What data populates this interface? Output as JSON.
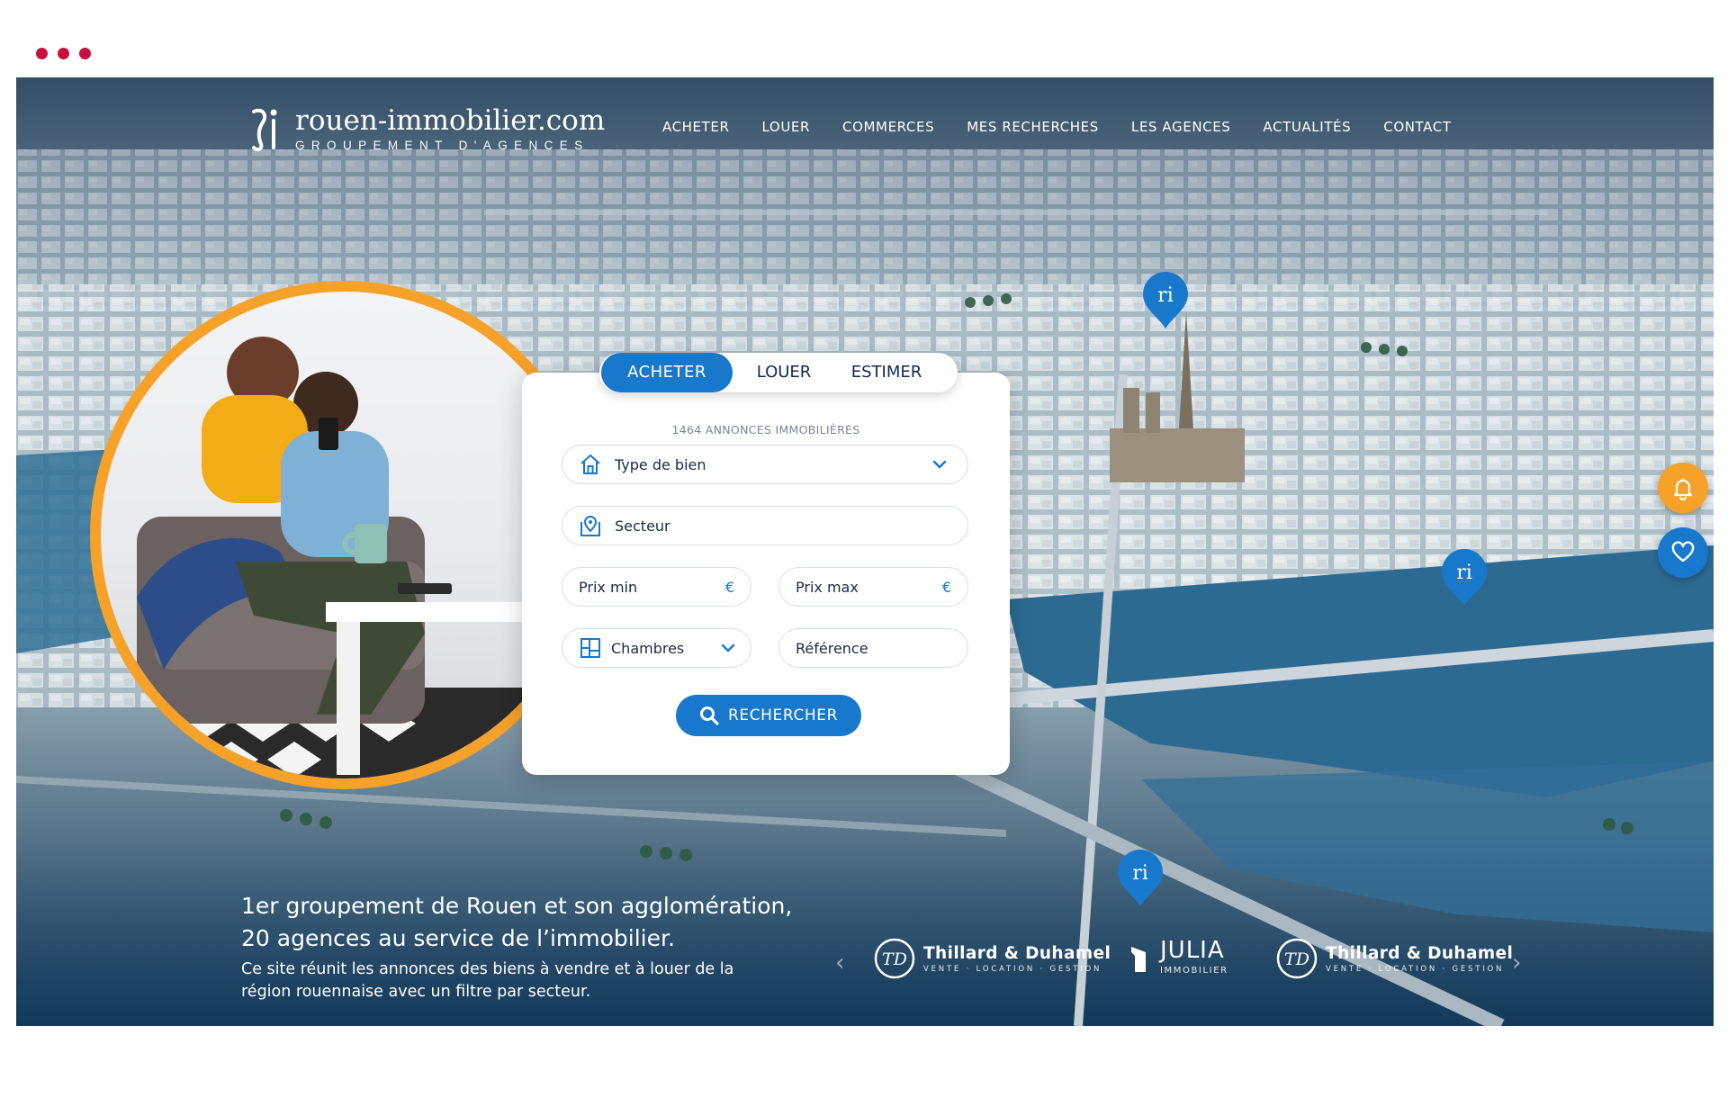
{
  "window": {
    "dot_colors": [
      "#c8103e",
      "#c8103e",
      "#c8103e"
    ]
  },
  "header": {
    "logo_title": "rouen-immobilier.com",
    "logo_subtitle": "GROUPEMENT D'AGENCES",
    "nav": [
      "ACHETER",
      "LOUER",
      "COMMERCES",
      "MES RECHERCHES",
      "LES AGENCES",
      "ACTUALITÉS",
      "CONTACT"
    ]
  },
  "search": {
    "tabs": [
      "ACHETER",
      "LOUER",
      "ESTIMER"
    ],
    "active_tab": "ACHETER",
    "count_label": "1464 ANNONCES IMMOBILIÈRES",
    "fields": {
      "type": "Type de bien",
      "secteur": "Secteur",
      "prix_min": "Prix min",
      "prix_max": "Prix max",
      "currency": "€",
      "chambres": "Chambres",
      "reference": "Référence"
    },
    "submit": "RECHERCHER"
  },
  "hero": {
    "tagline_line1": "1er groupement de Rouen et son agglomération,",
    "tagline_line2": "20 agences au service de l’immobilier.",
    "desc_line1": "Ce site réunit les annonces des biens à vendre et à louer de la",
    "desc_line2": "région rouennaise avec un filtre par secteur."
  },
  "partners": [
    {
      "name": "Thillard & Duhamel",
      "sub": "VENTE · LOCATION · GESTION",
      "mark": "TD"
    },
    {
      "name": "JULIA",
      "sub": "IMMOBILIER"
    },
    {
      "name": "Thillard & Duhamel",
      "sub": "VENTE · LOCATION · GESTION",
      "mark": "TD"
    }
  ],
  "colors": {
    "accent": "#1878cc",
    "orange": "#f6a22a",
    "dark_text": "#13294a"
  },
  "icons": {
    "bell": "bell-icon",
    "heart": "heart-icon",
    "search": "search-icon"
  }
}
